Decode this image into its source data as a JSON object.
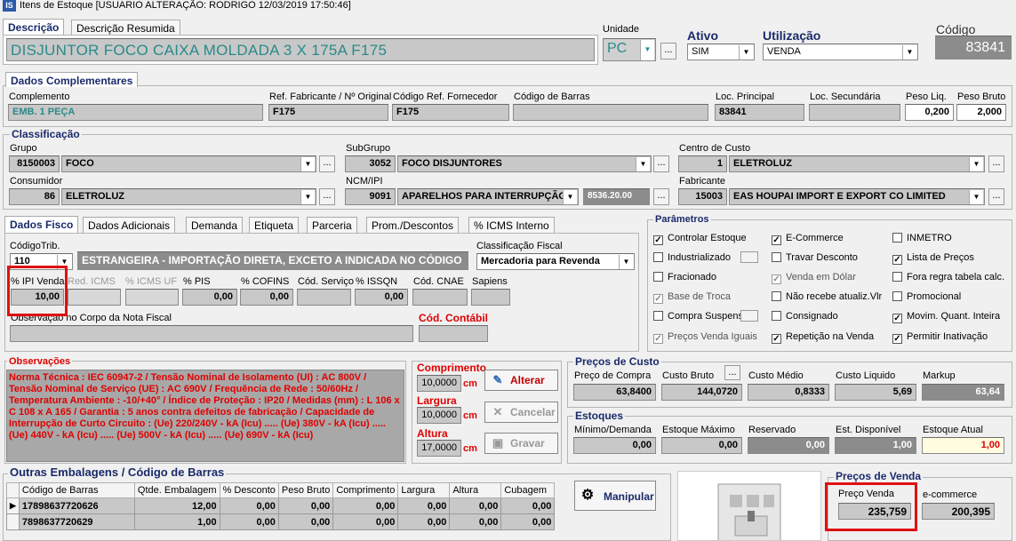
{
  "window": {
    "title": "Itens de Estoque  [USUARIO ALTERAÇÃO: RODRIGO 12/03/2019 17:50:46]",
    "icon_text": "IS"
  },
  "top": {
    "tab_descricao": "Descrição",
    "tab_resumida": "Descrição Resumida",
    "descricao": "DISJUNTOR FOCO CAIXA MOLDADA 3 X 175A    F175",
    "unidade_label": "Unidade",
    "unidade": "PC",
    "ativo_label": "Ativo",
    "ativo": "SIM",
    "utilizacao_label": "Utilização",
    "utilizacao": "VENDA",
    "codigo_label": "Código",
    "codigo": "83841"
  },
  "dados_comp": {
    "title": "Dados Complementares",
    "complemento_label": "Complemento",
    "complemento": "EMB. 1 PEÇA",
    "ref_fab_label": "Ref. Fabricante / Nº Original",
    "ref_fab": "F175",
    "cod_ref_forn_label": "Código Ref. Fornecedor",
    "cod_ref_forn": "F175",
    "cod_barras_label": "Código de Barras",
    "cod_barras": "",
    "loc_principal_label": "Loc. Principal",
    "loc_principal": "83841",
    "loc_secundaria_label": "Loc. Secundária",
    "loc_secundaria": "",
    "peso_liq_label": "Peso Liq.",
    "peso_liq": "0,200",
    "peso_bruto_label": "Peso Bruto",
    "peso_bruto": "2,000"
  },
  "classif": {
    "title": "Classificação",
    "grupo_label": "Grupo",
    "grupo_cod": "8150003",
    "grupo": "FOCO",
    "subgrupo_label": "SubGrupo",
    "subgrupo_cod": "3052",
    "subgrupo": "FOCO DISJUNTORES",
    "centro_label": "Centro de Custo",
    "centro_cod": "1",
    "centro": "ELETROLUZ",
    "consumidor_label": "Consumidor",
    "consumidor_cod": "86",
    "consumidor": "ELETROLUZ",
    "ncm_label": "NCM/IPI",
    "ncm_cod": "9091",
    "ncm": "APARELHOS PARA INTERRUPÇÃO,",
    "ncm_num": "8536.20.00",
    "fabricante_label": "Fabricante",
    "fabricante_cod": "15003",
    "fabricante": "EAS HOUPAI IMPORT E EXPORT CO LIMITED"
  },
  "fisco_tabs": [
    "Dados Fisco",
    "Dados Adicionais",
    "Demanda",
    "Etiqueta",
    "Parceria",
    "Prom./Descontos",
    "% ICMS Interno"
  ],
  "fisco": {
    "cod_trib_label": "CódigoTrib.",
    "cod_trib": "110",
    "cod_trib_desc": "ESTRANGEIRA - IMPORTAÇÃO DIRETA, EXCETO A INDICADA NO CÓDIGO",
    "classif_fiscal_label": "Classificação Fiscal",
    "classif_fiscal": "Mercadoria para Revenda",
    "ipi_label": "% IPI Venda",
    "ipi": "10,00",
    "red_icms_label": "Red. ICMS",
    "icms_uf_label": "% ICMS UF",
    "pis_label": "% PIS",
    "pis": "0,00",
    "cofins_label": "% COFINS",
    "cofins": "0,00",
    "cod_servico_label": "Cód. Serviço",
    "issqn_label": "% ISSQN",
    "issqn": "0,00",
    "cnae_label": "Cód. CNAE",
    "sapiens_label": "Sapiens",
    "obs_nf_label": "Observação no Corpo da Nota Fiscal",
    "cod_contabil_label": "Cód. Contábil"
  },
  "parametros": {
    "title": "Parâmetros",
    "items": [
      {
        "label": "Controlar Estoque",
        "checked": true,
        "disabled": false
      },
      {
        "label": "E-Commerce",
        "checked": true,
        "disabled": false
      },
      {
        "label": "INMETRO",
        "checked": false,
        "disabled": false
      },
      {
        "label": "Industrializado",
        "checked": false,
        "disabled": false
      },
      {
        "label": "Travar Desconto",
        "checked": false,
        "disabled": false
      },
      {
        "label": "Lista de Preços",
        "checked": true,
        "disabled": false
      },
      {
        "label": "Fracionado",
        "checked": false,
        "disabled": false
      },
      {
        "label": "Venda em Dólar",
        "checked": true,
        "disabled": true
      },
      {
        "label": "Fora regra tabela calc.",
        "checked": false,
        "disabled": false
      },
      {
        "label": "Base de Troca",
        "checked": true,
        "disabled": true
      },
      {
        "label": "Não recebe atualiz.Vlr",
        "checked": false,
        "disabled": false
      },
      {
        "label": "Promocional",
        "checked": false,
        "disabled": false
      },
      {
        "label": "Compra Suspensa",
        "checked": false,
        "disabled": false
      },
      {
        "label": "Consignado",
        "checked": false,
        "disabled": false
      },
      {
        "label": "Movim. Quant. Inteira",
        "checked": true,
        "disabled": false
      },
      {
        "label": "Preços Venda Iguais",
        "checked": true,
        "disabled": true
      },
      {
        "label": "Repetição na Venda",
        "checked": true,
        "disabled": false
      },
      {
        "label": "Permitir Inativação",
        "checked": true,
        "disabled": false
      }
    ]
  },
  "observacoes": {
    "title": "Observações",
    "text": "Norma Técnica : IEC 60947-2 / Tensão Nominal de Isolamento (UI) : AC 800V / Tensão Nominal de Serviço (UE) : AC 690V / Frequência de Rede : 50/60Hz / Temperatura Ambiente : -10/+40° / Índice de Proteção : IP20 / Medidas (mm) : L 106 x C 108 x A 165 / Garantia : 5 anos contra defeitos de fabricação / Capacidade de Interrupção de Curto Circuito : (Ue) 220/240V - kA (Icu) ..... (Ue) 380V - kA (Icu) ..... (Ue) 440V - kA (Icu) ..... (Ue) 500V - kA (Icu) ..... (Ue) 690V - kA (Icu)"
  },
  "dims": {
    "comprimento_label": "Comprimento",
    "comprimento": "10,0000",
    "largura_label": "Largura",
    "largura": "10,0000",
    "altura_label": "Altura",
    "altura": "17,0000",
    "unit": "cm",
    "alterar": "Alterar",
    "cancelar": "Cancelar",
    "gravar": "Gravar"
  },
  "custo": {
    "title": "Preços de Custo",
    "compra_label": "Preço de Compra",
    "compra": "63,8400",
    "bruto_label": "Custo Bruto",
    "bruto": "144,0720",
    "medio_label": "Custo Médio",
    "medio": "0,8333",
    "liquido_label": "Custo Liquido",
    "liquido": "5,69",
    "markup_label": "Markup",
    "markup": "63,64"
  },
  "estoques": {
    "title": "Estoques",
    "min_label": "Mínimo/Demanda",
    "min": "0,00",
    "max_label": "Estoque Máximo",
    "max": "0,00",
    "reservado_label": "Reservado",
    "reservado": "0,00",
    "disp_label": "Est. Disponível",
    "disp": "1,00",
    "atual_label": "Estoque Atual",
    "atual": "1,00"
  },
  "embalagens": {
    "title": "Outras Embalagens / Código de Barras",
    "columns": [
      "Código de Barras",
      "Qtde. Embalagem",
      "% Desconto",
      "Peso Bruto",
      "Comprimento",
      "Largura",
      "Altura",
      "Cubagem"
    ],
    "rows": [
      [
        "17898637720626",
        "12,00",
        "0,00",
        "0,00",
        "0,00",
        "0,00",
        "0,00",
        "0,00"
      ],
      [
        "7898637720629",
        "1,00",
        "0,00",
        "0,00",
        "0,00",
        "0,00",
        "0,00",
        "0,00"
      ]
    ],
    "manipular": "Manipular"
  },
  "venda": {
    "title": "Preços de Venda",
    "preco_label": "Preço Venda",
    "preco": "235,759",
    "ecommerce_label": "e-commerce",
    "ecommerce": "200,395"
  },
  "colors": {
    "title_blue": "#1a2a6a",
    "descricao_text": "#2a8a8a",
    "obs_red": "#e00000",
    "highlight_red": "#e01010"
  }
}
